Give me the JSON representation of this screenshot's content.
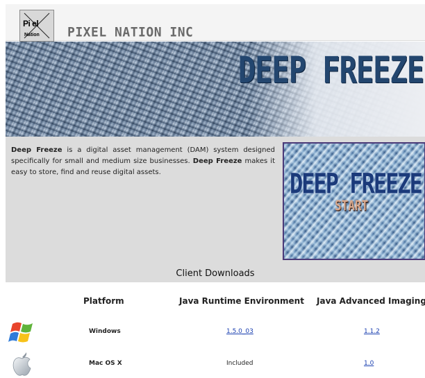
{
  "header": {
    "logo": {
      "line1": "Pi el",
      "line2": "Nation"
    },
    "company_name": "PIXEL NATION INC"
  },
  "banner": {
    "title": "DEEP FREEZE"
  },
  "intro": {
    "part1_bold": "Deep Freeze",
    "part2": " is a digital asset management (DAM) system designed specifically for small and medium size businesses. ",
    "part3_bold": "Deep Freeze",
    "part4": " makes it easy to store, find and reuse digital assets."
  },
  "start_panel": {
    "title": "DEEP FREEZE",
    "button": "START"
  },
  "downloads": {
    "title": "Client Downloads",
    "columns": [
      "Platform",
      "Java Runtime Environment",
      "Java Advanced Imaging"
    ],
    "rows": [
      {
        "platform": "Windows",
        "jre": "1.5.0_03",
        "jai": "1.1.2",
        "icon": "windows-logo-icon"
      },
      {
        "platform": "Mac OS X",
        "jre": "Included",
        "jai": "1.0",
        "icon": "apple-logo-icon"
      }
    ]
  },
  "colors": {
    "banner_title": "#23466f",
    "content_bg": "#dcdcdc",
    "link": "#1a3fb0"
  }
}
